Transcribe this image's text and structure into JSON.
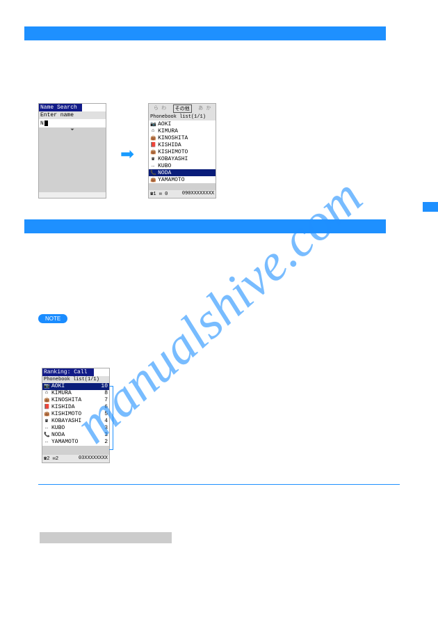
{
  "nameSearch": {
    "title": "Name Search",
    "prompt": "Enter name",
    "inputPrefix": "N"
  },
  "phonebook": {
    "tabs_inactive_left": "ら わ",
    "tabs_active": "その他",
    "tabs_inactive_right": "あ か",
    "header": "Phonebook list(1/1)",
    "items": [
      {
        "icon": "📷",
        "name": "AOKI"
      },
      {
        "icon": "⌂",
        "name": "KIMURA"
      },
      {
        "icon": "👜",
        "name": "KINOSHITA"
      },
      {
        "icon": "📕",
        "name": "KISHIDA"
      },
      {
        "icon": "👜",
        "name": "KISHIMOTO"
      },
      {
        "icon": "☎",
        "name": "KOBAYASHI"
      },
      {
        "icon": "…",
        "name": "KUBO"
      },
      {
        "icon": "📞",
        "name": "NODA"
      },
      {
        "icon": "👜",
        "name": "YAMAMOTO"
      }
    ],
    "selectedIndex": 7,
    "status_left": "☎1  ✉ 0",
    "status_right": "090XXXXXXXX"
  },
  "noteLabel": "NOTE",
  "ranking": {
    "title": "Ranking: Call",
    "header": "Phonebook list(1/1)",
    "items": [
      {
        "icon": "📷",
        "name": "AOKI",
        "count": "10"
      },
      {
        "icon": "⌂",
        "name": "KIMURA",
        "count": "8"
      },
      {
        "icon": "👜",
        "name": "KINOSHITA",
        "count": "7"
      },
      {
        "icon": "📕",
        "name": "KISHIDA",
        "count": "6"
      },
      {
        "icon": "👜",
        "name": "KISHIMOTO",
        "count": "5"
      },
      {
        "icon": "☎",
        "name": "KOBAYASHI",
        "count": "4"
      },
      {
        "icon": "…",
        "name": "KUBO",
        "count": "3"
      },
      {
        "icon": "📞",
        "name": "NODA",
        "count": "3"
      },
      {
        "icon": "…",
        "name": "YAMAMOTO",
        "count": "2"
      }
    ],
    "selectedIndex": 0,
    "status_left": "☎2  ✉2",
    "status_right": "03XXXXXXXX"
  },
  "watermark": "manualshive.com"
}
